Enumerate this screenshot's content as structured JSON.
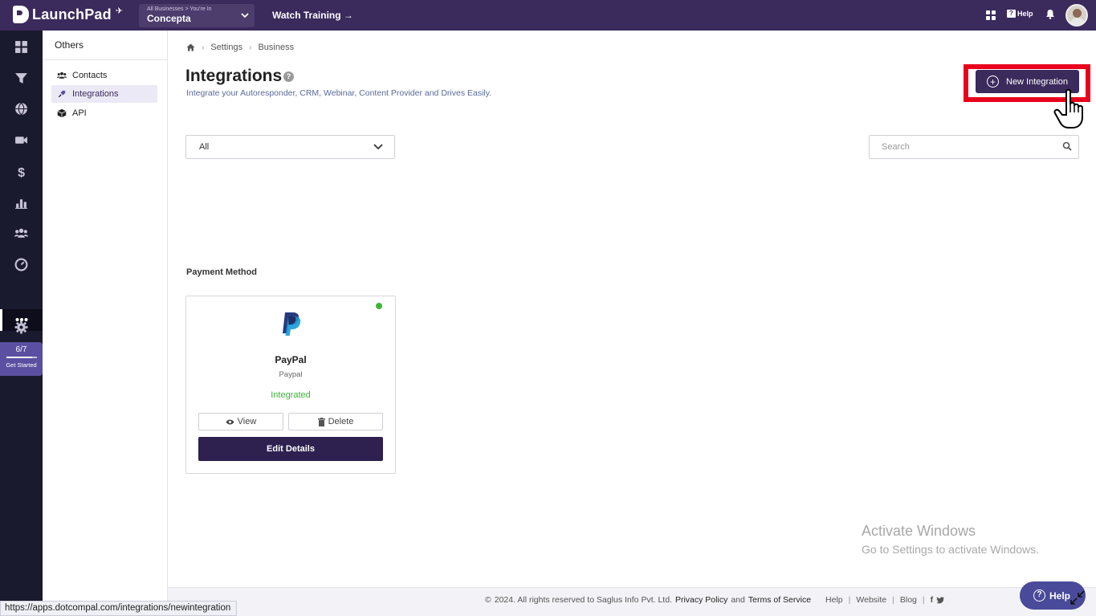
{
  "topbar": {
    "brand": "LaunchPad",
    "business_caption": "All Businesses > You're In",
    "business_name": "Concepta",
    "watch_training": "Watch Training →",
    "help_label": "Help"
  },
  "rail": {
    "items": [
      "dashboard-icon",
      "funnel-icon",
      "globe-icon",
      "video-icon",
      "dollar-icon",
      "chart-icon",
      "users-icon",
      "gauge-icon",
      "more-icon",
      "gear-icon"
    ],
    "get_started_count": "6/7",
    "get_started_progress": 0.857,
    "get_started_label": "Get Started"
  },
  "subsidebar": {
    "heading": "Others",
    "items": [
      {
        "label": "Contacts",
        "icon": "users-icon",
        "active": false
      },
      {
        "label": "Integrations",
        "icon": "plug-icon",
        "active": true
      },
      {
        "label": "API",
        "icon": "cube-icon",
        "active": false
      }
    ]
  },
  "breadcrumb": {
    "items": [
      "Settings",
      "Business"
    ]
  },
  "page": {
    "title": "Integrations",
    "subtitle": "Integrate your Autoresponder, CRM, Webinar, Content Provider and Drives Easily.",
    "new_button": "New Integration",
    "filter_value": "All",
    "search_placeholder": "Search"
  },
  "section": {
    "label": "Payment Method",
    "cards": [
      {
        "name": "PayPal",
        "type": "Paypal",
        "status": "Integrated",
        "view_label": "View",
        "delete_label": "Delete",
        "edit_label": "Edit Details"
      }
    ]
  },
  "watermark": {
    "title": "Activate Windows",
    "subtitle": "Go to Settings to activate Windows."
  },
  "footer": {
    "copyright_symbol": "©",
    "copyright_text": "2024. All rights reserved to Saglus Info Pvt. Ltd.",
    "privacy": "Privacy Policy",
    "and": "and",
    "terms": "Terms of Service",
    "help": "Help",
    "website": "Website",
    "blog": "Blog"
  },
  "status_url": "https://apps.dotcompal.com/integrations/newintegration",
  "help_fab": "Help",
  "colors": {
    "topbar": "#3b2a5c",
    "rail": "#1a1a2e",
    "primary_button": "#2e2150",
    "highlight": "#e8001c",
    "status_green": "#3db33a"
  }
}
